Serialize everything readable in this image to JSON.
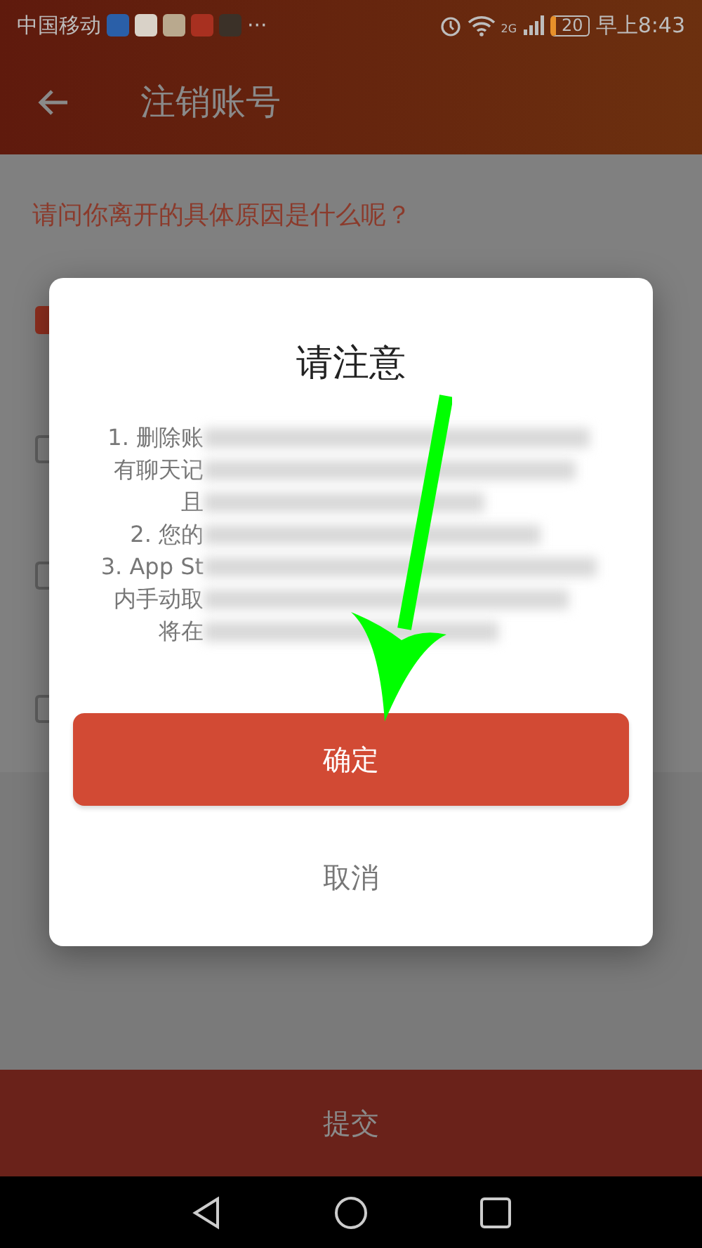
{
  "status_bar": {
    "carrier": "中国移动",
    "more": "···",
    "network": "2G",
    "battery": "20",
    "time": "早上8:43"
  },
  "header": {
    "title": "注销账号"
  },
  "question": "请问你离开的具体原因是什么呢？",
  "reasons": [
    {
      "checked": true
    },
    {
      "checked": false
    },
    {
      "checked": false
    },
    {
      "checked": false
    }
  ],
  "dialog": {
    "title": "请注意",
    "lines": [
      "1. 删除账",
      "有聊天记",
      "且",
      "2. 您的",
      "3. App St",
      "内手动取",
      "将在"
    ],
    "confirm": "确定",
    "cancel": "取消"
  },
  "submit": "提交"
}
